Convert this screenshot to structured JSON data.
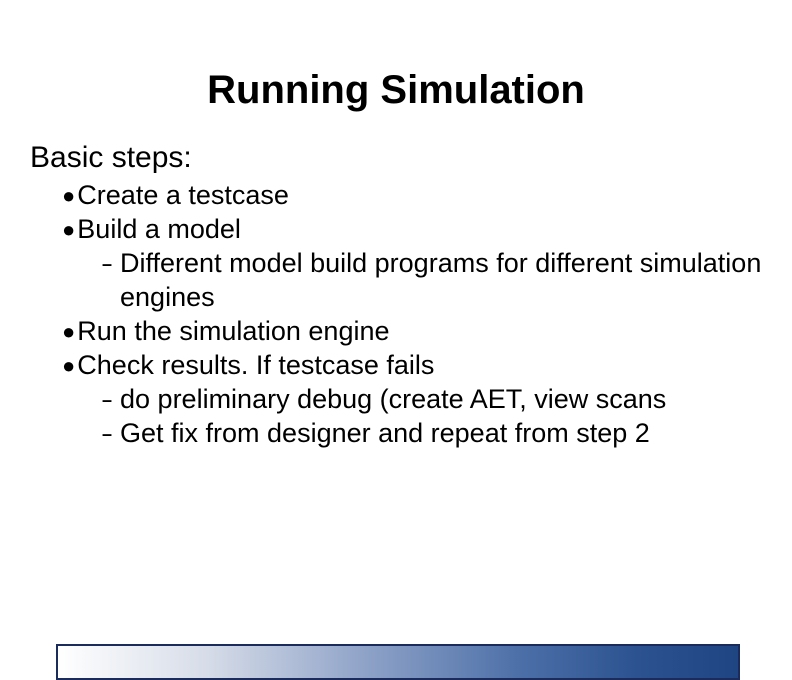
{
  "title": "Running Simulation",
  "subtitle": "Basic steps:",
  "bullets": {
    "b1": {
      "text": "Create a testcase"
    },
    "b2": {
      "text": "Build a model"
    },
    "b2_sub1": {
      "text": "Different model build programs for different simulation engines"
    },
    "b3": {
      "text": "Run the simulation engine"
    },
    "b4": {
      "text": "Check results.  If testcase fails"
    },
    "b4_sub1": {
      "text": "do preliminary debug (create AET, view scans"
    },
    "b4_sub2": {
      "text": "Get fix from designer and repeat from step 2"
    }
  }
}
